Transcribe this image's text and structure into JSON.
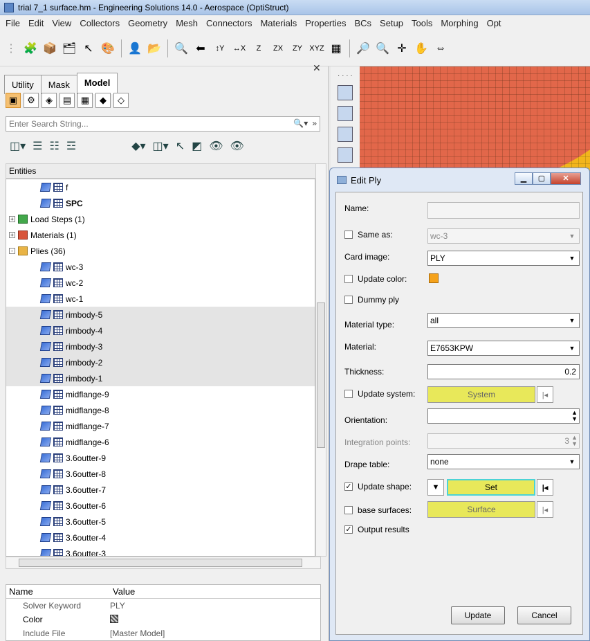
{
  "window": {
    "title": "trial 7_1 surface.hm - Engineering Solutions 14.0 - Aerospace (OptiStruct)"
  },
  "menu": [
    "File",
    "Edit",
    "View",
    "Collectors",
    "Geometry",
    "Mesh",
    "Connectors",
    "Materials",
    "Properties",
    "BCs",
    "Setup",
    "Tools",
    "Morphing",
    "Opt"
  ],
  "tabs": [
    "Utility",
    "Mask",
    "Model"
  ],
  "search": {
    "placeholder": "Enter Search String..."
  },
  "entities_label": "Entities",
  "tree": [
    {
      "label": "f",
      "icon": "ply",
      "indent": 2,
      "bold": false,
      "sel": false
    },
    {
      "label": "SPC",
      "icon": "ply",
      "indent": 2,
      "bold": true,
      "sel": false
    },
    {
      "label": "Load Steps (1)",
      "icon": "load",
      "indent": 0,
      "bold": false,
      "sel": false,
      "exp": "+"
    },
    {
      "label": "Materials (1)",
      "icon": "mat",
      "indent": 0,
      "bold": false,
      "sel": false,
      "exp": "+"
    },
    {
      "label": "Plies (36)",
      "icon": "folder",
      "indent": 0,
      "bold": false,
      "sel": false,
      "exp": "-"
    },
    {
      "label": "wc-3",
      "icon": "ply",
      "indent": 2,
      "bold": false,
      "sel": false
    },
    {
      "label": "wc-2",
      "icon": "ply",
      "indent": 2,
      "bold": false,
      "sel": false
    },
    {
      "label": "wc-1",
      "icon": "ply",
      "indent": 2,
      "bold": false,
      "sel": false
    },
    {
      "label": "rimbody-5",
      "icon": "ply",
      "indent": 2,
      "bold": false,
      "sel": true
    },
    {
      "label": "rimbody-4",
      "icon": "ply",
      "indent": 2,
      "bold": false,
      "sel": true
    },
    {
      "label": "rimbody-3",
      "icon": "ply",
      "indent": 2,
      "bold": false,
      "sel": true
    },
    {
      "label": "rimbody-2",
      "icon": "ply",
      "indent": 2,
      "bold": false,
      "sel": true
    },
    {
      "label": "rimbody-1",
      "icon": "ply",
      "indent": 2,
      "bold": false,
      "sel": true
    },
    {
      "label": "midflange-9",
      "icon": "ply",
      "indent": 2,
      "bold": false,
      "sel": false
    },
    {
      "label": "midflange-8",
      "icon": "ply",
      "indent": 2,
      "bold": false,
      "sel": false
    },
    {
      "label": "midflange-7",
      "icon": "ply",
      "indent": 2,
      "bold": false,
      "sel": false
    },
    {
      "label": "midflange-6",
      "icon": "ply",
      "indent": 2,
      "bold": false,
      "sel": false
    },
    {
      "label": "3.6outter-9",
      "icon": "ply",
      "indent": 2,
      "bold": false,
      "sel": false
    },
    {
      "label": "3.6outter-8",
      "icon": "ply",
      "indent": 2,
      "bold": false,
      "sel": false
    },
    {
      "label": "3.6outter-7",
      "icon": "ply",
      "indent": 2,
      "bold": false,
      "sel": false
    },
    {
      "label": "3.6outter-6",
      "icon": "ply",
      "indent": 2,
      "bold": false,
      "sel": false
    },
    {
      "label": "3.6outter-5",
      "icon": "ply",
      "indent": 2,
      "bold": false,
      "sel": false
    },
    {
      "label": "3.6outter-4",
      "icon": "ply",
      "indent": 2,
      "bold": false,
      "sel": false
    },
    {
      "label": "3.6outter-3",
      "icon": "ply",
      "indent": 2,
      "bold": false,
      "sel": false
    }
  ],
  "props": {
    "head": [
      "Name",
      "Value"
    ],
    "rows": [
      {
        "name": "Solver Keyword",
        "value": "PLY"
      },
      {
        "name": "Color",
        "value": ""
      },
      {
        "name": "Include File",
        "value": "[Master Model]"
      }
    ]
  },
  "dialog": {
    "title": "Edit Ply",
    "name_label": "Name:",
    "name_value": "",
    "same_as_label": "Same as:",
    "same_as_value": "wc-3",
    "card_image_label": "Card image:",
    "card_image_value": "PLY",
    "update_color_label": "Update color:",
    "update_color_swatch": "#f5a21b",
    "dummy_ply_label": "Dummy ply",
    "material_type_label": "Material type:",
    "material_type_value": "all",
    "material_label": "Material:",
    "material_value": "E7653KPW",
    "thickness_label": "Thickness:",
    "thickness_value": "0.2",
    "update_system_label": "Update system:",
    "system_button": "System",
    "orientation_label": "Orientation:",
    "orientation_value": "",
    "integration_label": "Integration points:",
    "integration_value": "3",
    "drape_label": "Drape table:",
    "drape_value": "none",
    "update_shape_label": "Update shape:",
    "set_button": "Set",
    "base_surfaces_label": "base surfaces:",
    "surface_button": "Surface",
    "output_results_label": "Output results",
    "update_button": "Update",
    "cancel_button": "Cancel"
  }
}
